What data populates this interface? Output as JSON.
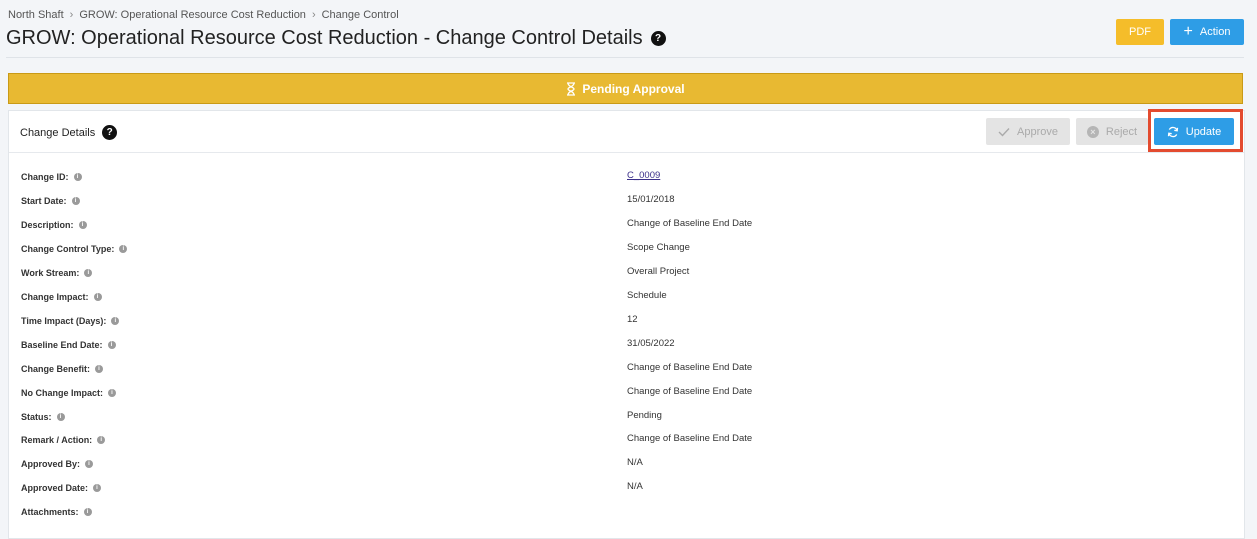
{
  "breadcrumb": [
    "North Shaft",
    "GROW: Operational Resource Cost Reduction",
    "Change Control"
  ],
  "page_title": "GROW: Operational Resource Cost Reduction - Change Control Details",
  "header_buttons": {
    "pdf": "PDF",
    "action": "Action"
  },
  "status_banner": "Pending Approval",
  "card": {
    "title": "Change Details",
    "approve": "Approve",
    "reject": "Reject",
    "update": "Update"
  },
  "details": [
    {
      "label": "Change ID:",
      "value": "C_0009"
    },
    {
      "label": "Start Date:",
      "value": "15/01/2018"
    },
    {
      "label": "Description:",
      "value": "Change of Baseline End Date"
    },
    {
      "label": "Change Control Type:",
      "value": "Scope Change"
    },
    {
      "label": "Work Stream:",
      "value": "Overall Project"
    },
    {
      "label": "Change Impact:",
      "value": "Schedule"
    },
    {
      "label": "Time Impact (Days):",
      "value": "12"
    },
    {
      "label": "Baseline End Date:",
      "value": "31/05/2022"
    },
    {
      "label": "Change Benefit:",
      "value": "Change of Baseline End Date"
    },
    {
      "label": "No Change Impact:",
      "value": "Change of Baseline End Date"
    },
    {
      "label": "Status:",
      "value": "Pending"
    },
    {
      "label": "Remark / Action:",
      "value": "Change of Baseline End Date"
    },
    {
      "label": "Approved By:",
      "value": "N/A"
    },
    {
      "label": "Approved Date:",
      "value": "N/A"
    },
    {
      "label": "Attachments:",
      "value": ""
    }
  ],
  "colors": {
    "banner": "#e8b932",
    "primary": "#2e9de6",
    "pdf": "#f5bd2a",
    "highlight": "#e34b2f"
  }
}
